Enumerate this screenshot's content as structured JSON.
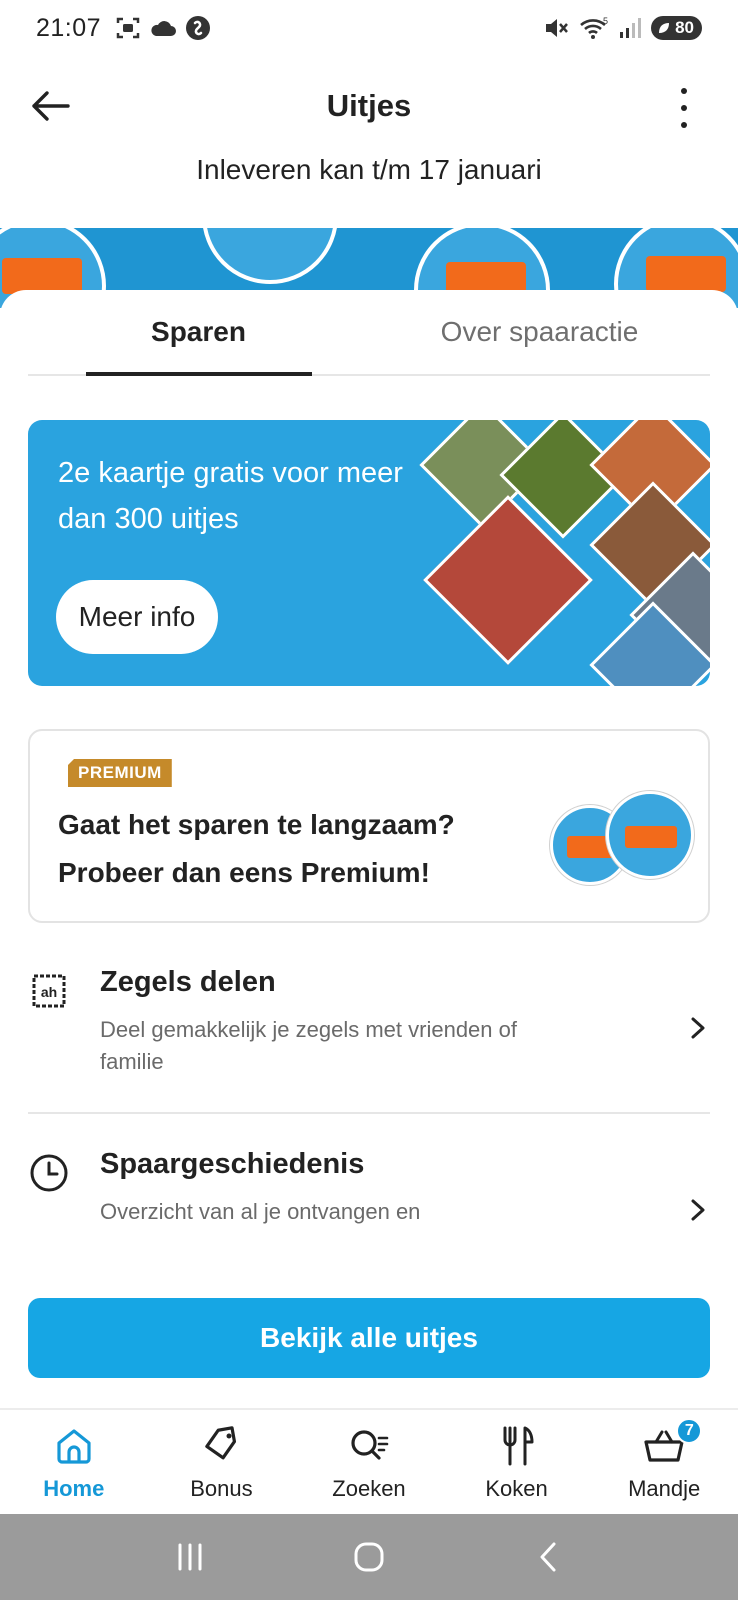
{
  "status_bar": {
    "time": "21:07",
    "battery": "80",
    "icons": [
      "screenshot-icon",
      "cloud-icon",
      "shazam-icon",
      "mute-icon",
      "wifi-icon",
      "signal-icon",
      "battery-icon"
    ]
  },
  "header": {
    "title": "Uitjes",
    "subtitle": "Inleveren kan t/m 17 januari"
  },
  "tabs": [
    {
      "label": "Sparen",
      "active": true
    },
    {
      "label": "Over spaaractie",
      "active": false
    }
  ],
  "promo": {
    "headline": "2e kaartje gratis voor meer dan 300 uitjes",
    "button": "Meer info"
  },
  "premium": {
    "badge": "PREMIUM",
    "text": "Gaat het sparen te langzaam? Probeer dan eens Premium!"
  },
  "list": [
    {
      "title": "Zegels delen",
      "description": "Deel gemakkelijk je zegels met vrienden of familie",
      "icon": "stamp-icon"
    },
    {
      "title": "Spaargeschiedenis",
      "description": "Overzicht van al je ontvangen en",
      "icon": "clock-icon"
    }
  ],
  "cta": "Bekijk alle uitjes",
  "bottom_nav": [
    {
      "label": "Home",
      "icon": "home-icon",
      "active": true
    },
    {
      "label": "Bonus",
      "icon": "tag-icon",
      "active": false
    },
    {
      "label": "Zoeken",
      "icon": "search-icon",
      "active": false
    },
    {
      "label": "Koken",
      "icon": "cutlery-icon",
      "active": false
    },
    {
      "label": "Mandje",
      "icon": "basket-icon",
      "active": false,
      "badge": "7"
    }
  ],
  "colors": {
    "accent": "#1598d7",
    "cta": "#16a6e4",
    "banner": "#2aa3df",
    "premium_badge": "#c58a2a",
    "ticket_orange": "#f26a1b"
  }
}
